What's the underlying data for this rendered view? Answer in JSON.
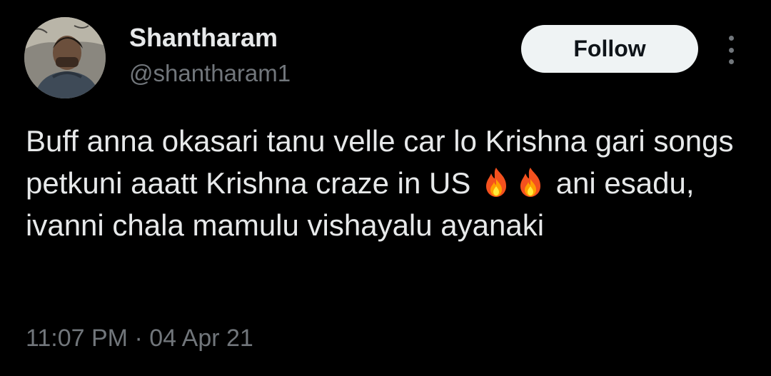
{
  "user": {
    "display_name": "Shantharam",
    "handle": "@shantharam1"
  },
  "actions": {
    "follow_label": "Follow",
    "more_icon": "more-vertical-icon"
  },
  "tweet": {
    "text_part1": "Buff anna okasari tanu velle car lo Krishna gari songs petkuni aaatt Krishna craze in US",
    "emoji": [
      "fire-icon",
      "fire-icon"
    ],
    "text_part2": "ani esadu, ivanni chala mamulu vishayalu ayanaki"
  },
  "meta": {
    "time": "11:07 PM",
    "separator": "·",
    "date": "04 Apr 21"
  },
  "colors": {
    "background": "#000000",
    "text": "#e7e9ea",
    "muted": "#71767b",
    "button_bg": "#eff3f4",
    "button_text": "#0f1419"
  }
}
